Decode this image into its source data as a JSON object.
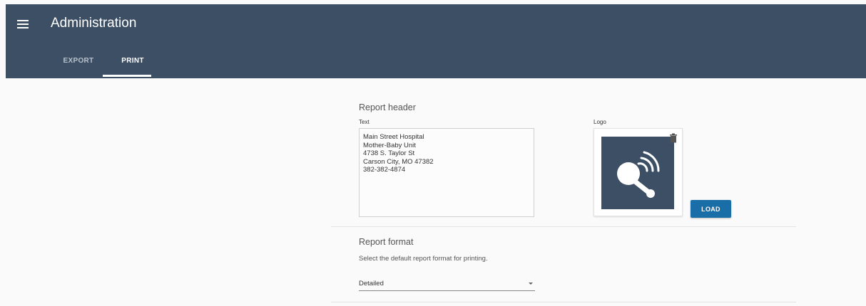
{
  "appbar": {
    "title": "Administration",
    "menu_icon": "hamburger-menu-icon",
    "color": "#3c4f64"
  },
  "tabs": [
    {
      "label": "EXPORT",
      "active": false
    },
    {
      "label": "PRINT",
      "active": true
    }
  ],
  "report_header": {
    "title": "Report header",
    "text_label": "Text",
    "text_value": "Main Street Hospital\nMother-Baby Unit\n4738 S. Taylor St\nCarson City, MO 47382\n382-382-4874",
    "logo_label": "Logo",
    "logo_icon": "baby-rattle-icon",
    "delete_icon": "trash-icon",
    "load_label": "LOAD",
    "accent": "#1a6ea8"
  },
  "report_format": {
    "title": "Report format",
    "description": "Select the default report format for printing.",
    "selected": "Detailed"
  }
}
